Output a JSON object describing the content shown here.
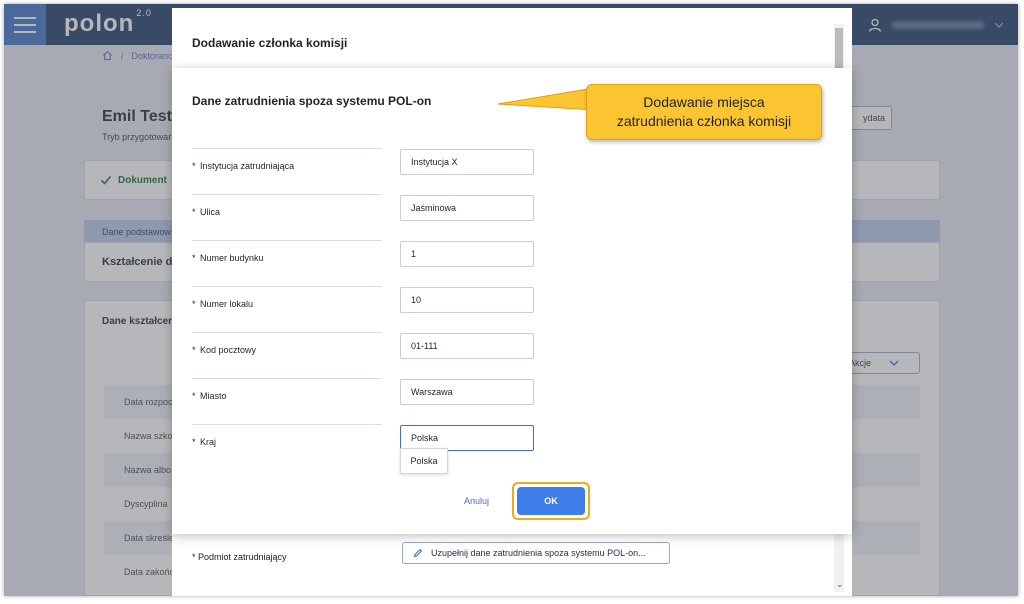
{
  "topbar": {
    "logo_text": "polon",
    "logo_version": "2.0",
    "icons": [
      "hamburger-icon",
      "user-icon",
      "chevron-down-icon"
    ]
  },
  "breadcrumb": {
    "home_icon": "home-icon",
    "separator": "/",
    "item": "Doktoranc"
  },
  "background": {
    "person_name": "Emil Testo",
    "person_sub": "Tryb przygotowar",
    "right_button": "ydata",
    "document_status": "Dokument",
    "tab_label": "Dane podstawow",
    "section1_title": "Kształcenie d",
    "section2_title": "Dane kształcer",
    "actions_label": "Akcje",
    "table_rows": [
      "Data rozpoc",
      "Nazwa szko",
      "Nazwa albo",
      "Dyscyplina",
      "Data skreśle",
      "Data zakońc"
    ],
    "podmiot_label": "* Podmiot zatrudniający",
    "fill_button_label": "Uzupełnij dane zatrudnienia spoza systemu POL-on..."
  },
  "back_modal": {
    "title": "Dodawanie członka komisji"
  },
  "modal": {
    "title": "Dane zatrudnienia spoza systemu POL-on",
    "required_marker": "*",
    "fields": [
      {
        "label": "Instytucja zatrudniająca",
        "value": "Instytucja X"
      },
      {
        "label": "Ulica",
        "value": "Jaśminowa"
      },
      {
        "label": "Numer budynku",
        "value": "1"
      },
      {
        "label": "Numer lokalu",
        "value": "10"
      },
      {
        "label": "Kod pocztowy",
        "value": "01-111"
      },
      {
        "label": "Miasto",
        "value": "Warszawa"
      },
      {
        "label": "Kraj",
        "value": "Polska"
      }
    ],
    "suggestion": "Polska",
    "cancel_label": "Anuluj",
    "ok_label": "OK"
  },
  "callout": {
    "line1": "Dodawanie miejsca",
    "line2": "zatrudnienia członka komisji"
  },
  "colors": {
    "topbar": "#1c3a63",
    "accent": "#3f7de8",
    "highlight": "#f0a91b",
    "callout": "#fbc531"
  }
}
